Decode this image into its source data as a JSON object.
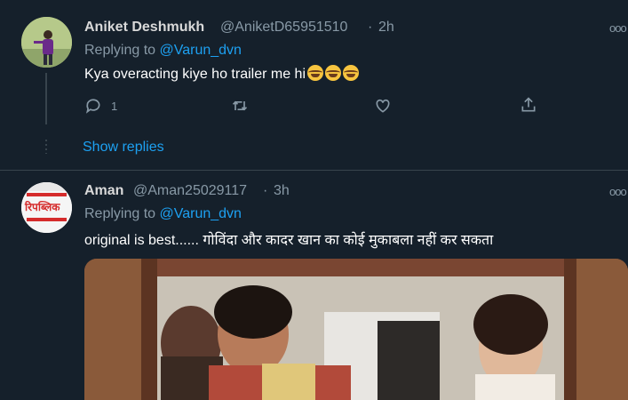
{
  "tweets": [
    {
      "name": "Aniket Deshmukh",
      "handle": "@AniketD65951510",
      "sep": "·",
      "time": "2h",
      "replying_prefix": "Replying to",
      "replying_to": "@Varun_dvn",
      "text": "Kya overacting kiye ho trailer me hi",
      "emoji_count": 3,
      "reply_count": "1",
      "more": "ooo"
    },
    {
      "name": "Aman",
      "handle": "@Aman25029117",
      "sep": "·",
      "time": "3h",
      "replying_prefix": "Replying to",
      "replying_to": "@Varun_dvn",
      "text": "original is best...... गोविंदा और कादर खान का कोई मुकाबला नहीं कर सकता",
      "avatar_text": "रिपब्लिक",
      "more": "ooo"
    }
  ],
  "show_replies": "Show replies",
  "colors": {
    "bg": "#15202b",
    "accent": "#1da1f2",
    "muted": "#8899a6",
    "divider": "#38444d"
  }
}
